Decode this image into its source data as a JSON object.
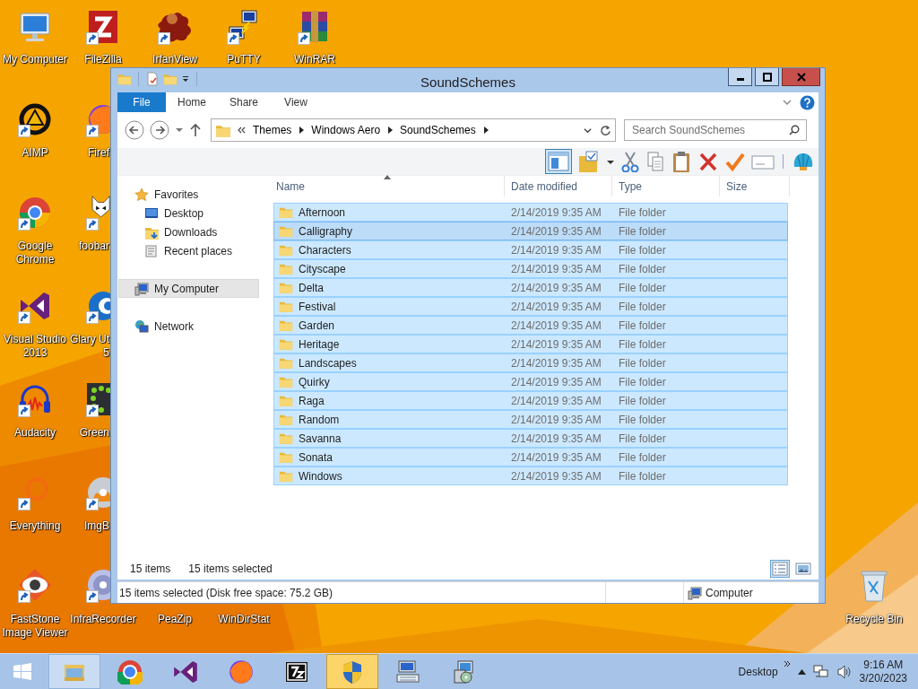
{
  "desktop_icons": [
    {
      "label": "My Computer",
      "shortcut": false
    },
    {
      "label": "FileZilla",
      "shortcut": true
    },
    {
      "label": "IrfanView",
      "shortcut": true
    },
    {
      "label": "PuTTY",
      "shortcut": true
    },
    {
      "label": "WinRAR",
      "shortcut": true
    },
    {
      "label": "AIMP",
      "shortcut": true
    },
    {
      "label": "Firef",
      "shortcut": true
    },
    {
      "label": "Google Chrome",
      "shortcut": true
    },
    {
      "label": "foobar",
      "shortcut": true
    },
    {
      "label": "Visual Studio 2013",
      "shortcut": true
    },
    {
      "label": "Glary Ut\n5",
      "shortcut": true
    },
    {
      "label": "Audacity",
      "shortcut": true
    },
    {
      "label": "Green",
      "shortcut": true
    },
    {
      "label": "Everything",
      "shortcut": true
    },
    {
      "label": "ImgB",
      "shortcut": true
    },
    {
      "label": "FastStone Image Viewer",
      "shortcut": true
    },
    {
      "label": "InfraRecorder",
      "shortcut": true
    },
    {
      "label": "PeaZip"
    },
    {
      "label": "WinDirStat"
    },
    {
      "label": "Recycle Bin",
      "shortcut": false
    }
  ],
  "window": {
    "title": "SoundSchemes",
    "ribbon_tabs": [
      {
        "label": "File",
        "kind": "file"
      },
      {
        "label": "Home",
        "kind": "tab"
      },
      {
        "label": "Share",
        "kind": "tab"
      },
      {
        "label": "View",
        "kind": "tab"
      }
    ],
    "address": {
      "crumbs": [
        "Themes",
        "Windows Aero",
        "SoundSchemes"
      ]
    },
    "search": {
      "placeholder": "Search SoundSchemes"
    },
    "toolbar": {
      "preview_pane": {
        "on": true
      }
    },
    "nav": [
      {
        "label": "Favorites",
        "selected": false,
        "children": [
          {
            "label": "Desktop",
            "selected": false
          },
          {
            "label": "Downloads",
            "selected": false
          },
          {
            "label": "Recent places",
            "selected": false
          }
        ]
      },
      {
        "label": "My Computer",
        "selected": true
      },
      {
        "label": "Network",
        "selected": false
      }
    ],
    "columns": [
      {
        "label": "Name",
        "sorted": true
      },
      {
        "label": "Date modified",
        "sorted": false
      },
      {
        "label": "Type",
        "sorted": false
      },
      {
        "label": "Size",
        "sorted": false
      }
    ],
    "files": [
      {
        "name": "Afternoon",
        "date": "2/14/2019 9:35 AM",
        "type": "File folder",
        "selected": true,
        "focused": false
      },
      {
        "name": "Calligraphy",
        "date": "2/14/2019 9:35 AM",
        "type": "File folder",
        "selected": true,
        "focused": true
      },
      {
        "name": "Characters",
        "date": "2/14/2019 9:35 AM",
        "type": "File folder",
        "selected": true,
        "focused": false
      },
      {
        "name": "Cityscape",
        "date": "2/14/2019 9:35 AM",
        "type": "File folder",
        "selected": true,
        "focused": false
      },
      {
        "name": "Delta",
        "date": "2/14/2019 9:35 AM",
        "type": "File folder",
        "selected": true,
        "focused": false
      },
      {
        "name": "Festival",
        "date": "2/14/2019 9:35 AM",
        "type": "File folder",
        "selected": true,
        "focused": false
      },
      {
        "name": "Garden",
        "date": "2/14/2019 9:35 AM",
        "type": "File folder",
        "selected": true,
        "focused": false
      },
      {
        "name": "Heritage",
        "date": "2/14/2019 9:35 AM",
        "type": "File folder",
        "selected": true,
        "focused": false
      },
      {
        "name": "Landscapes",
        "date": "2/14/2019 9:35 AM",
        "type": "File folder",
        "selected": true,
        "focused": false
      },
      {
        "name": "Quirky",
        "date": "2/14/2019 9:35 AM",
        "type": "File folder",
        "selected": true,
        "focused": false
      },
      {
        "name": "Raga",
        "date": "2/14/2019 9:35 AM",
        "type": "File folder",
        "selected": true,
        "focused": false
      },
      {
        "name": "Random",
        "date": "2/14/2019 9:35 AM",
        "type": "File folder",
        "selected": true,
        "focused": false
      },
      {
        "name": "Savanna",
        "date": "2/14/2019 9:35 AM",
        "type": "File folder",
        "selected": true,
        "focused": false
      },
      {
        "name": "Sonata",
        "date": "2/14/2019 9:35 AM",
        "type": "File folder",
        "selected": true,
        "focused": false
      },
      {
        "name": "Windows",
        "date": "2/14/2019 9:35 AM",
        "type": "File folder",
        "selected": true,
        "focused": false
      }
    ],
    "item_count": "15 items",
    "selection_count": "15 items selected",
    "views": [
      {
        "kind": "details",
        "selected": true
      },
      {
        "kind": "large-icons",
        "selected": false
      }
    ],
    "status_bar": {
      "text": "15 items selected (Disk free space: 75.2 GB)",
      "location": "Computer"
    }
  },
  "taskbar": {
    "buttons": [
      {
        "open": true,
        "active": false
      },
      {
        "open": false,
        "active": false
      },
      {
        "open": false,
        "active": false
      },
      {
        "open": false,
        "active": false
      },
      {
        "open": false,
        "active": false
      },
      {
        "open": true,
        "active": true
      },
      {
        "open": false,
        "active": false
      },
      {
        "open": false,
        "active": false
      }
    ],
    "toolbar_label": "Desktop",
    "clock": {
      "time": "9:16 AM",
      "date": "3/20/2023"
    }
  }
}
